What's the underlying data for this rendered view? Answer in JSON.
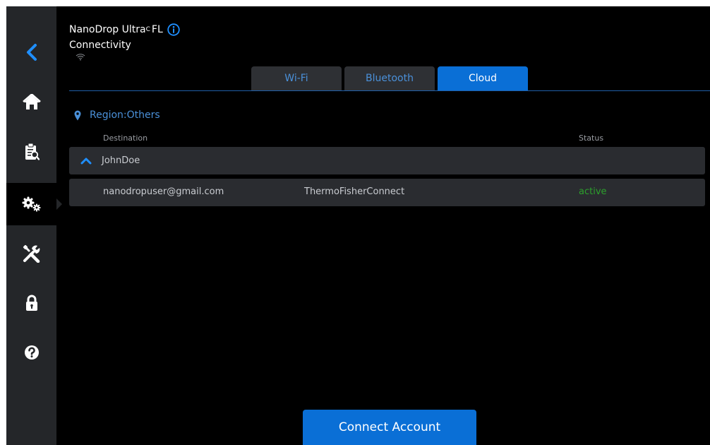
{
  "header": {
    "product_name": "NanoDrop Ultra",
    "product_sup": "C",
    "product_suffix": "FL",
    "page_title": "Connectivity"
  },
  "tabs": [
    {
      "label": "Wi-Fi",
      "active": false
    },
    {
      "label": "Bluetooth",
      "active": false
    },
    {
      "label": "Cloud",
      "active": true
    }
  ],
  "region": {
    "label": "Region:Others"
  },
  "table": {
    "columns": [
      "Destination",
      "Status"
    ],
    "group": {
      "name": "JohnDoe",
      "expanded": true
    },
    "rows": [
      {
        "email": "nanodropuser@gmail.com",
        "service": "ThermoFisherConnect",
        "status": "active"
      }
    ]
  },
  "actions": {
    "connect_label": "Connect Account"
  },
  "sidebar": {
    "items": [
      {
        "icon": "back-arrow-icon"
      },
      {
        "icon": "home-icon"
      },
      {
        "icon": "clipboard-search-icon"
      },
      {
        "icon": "settings-gears-icon",
        "active": true
      },
      {
        "icon": "tools-icon"
      },
      {
        "icon": "lock-icon"
      },
      {
        "icon": "help-icon"
      }
    ]
  },
  "colors": {
    "accent": "#0a6fd6",
    "link_blue": "#4a90d9",
    "status_active": "#2ca02c",
    "sidebar_bg": "#242629"
  }
}
